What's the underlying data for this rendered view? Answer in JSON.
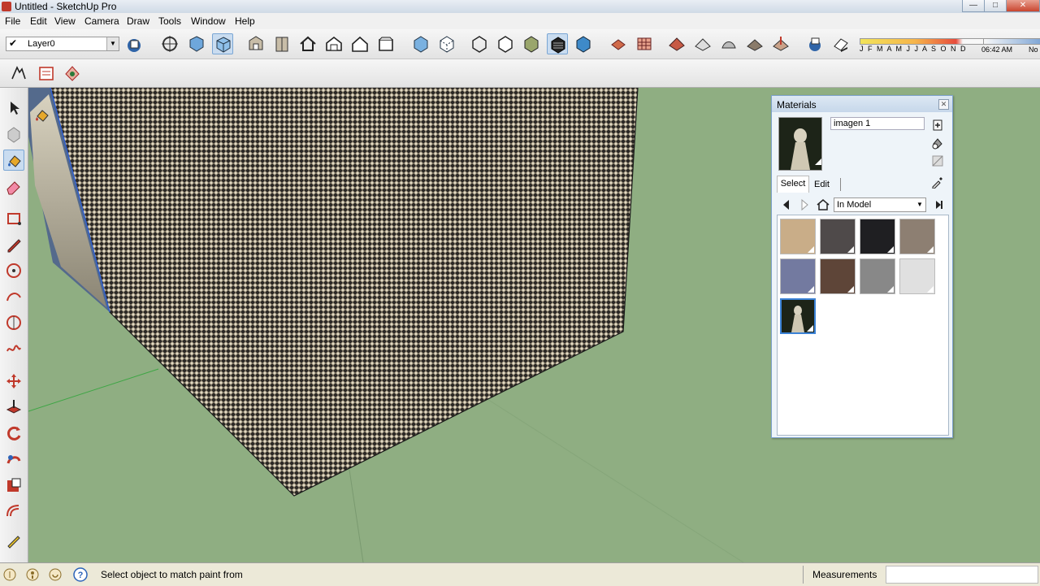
{
  "window": {
    "title": "Untitled - SketchUp Pro",
    "controls": {
      "minimize": "—",
      "maximize": "□",
      "close": "✕"
    }
  },
  "menu": [
    "File",
    "Edit",
    "View",
    "Camera",
    "Draw",
    "Tools",
    "Window",
    "Help"
  ],
  "toolbar": {
    "layer": {
      "checkmark": "✔",
      "name": "Layer0"
    },
    "shadow": {
      "months": "J F M A M J J A S O N D",
      "time": "06:42 AM",
      "noon": "No"
    }
  },
  "status": {
    "message": "Select object to match paint from",
    "measurements_label": "Measurements"
  },
  "materials": {
    "title": "Materials",
    "close": "✕",
    "name": "imagen 1",
    "tabs": {
      "select": "Select",
      "edit": "Edit"
    },
    "collection": "In Model",
    "swatches": [
      {
        "color": "#c9ad88"
      },
      {
        "color": "#4f4a4a"
      },
      {
        "color": "#1f1f22"
      },
      {
        "color": "#8d7f72"
      },
      {
        "color": "#737aa0"
      },
      {
        "color": "#5e4538"
      },
      {
        "color": "#888888"
      },
      {
        "color": "#e0e0e0"
      },
      {
        "color": "image",
        "selected": true
      }
    ]
  },
  "colors": {
    "viewport_bg": "#8fae82",
    "selection": "#3b82d6"
  }
}
